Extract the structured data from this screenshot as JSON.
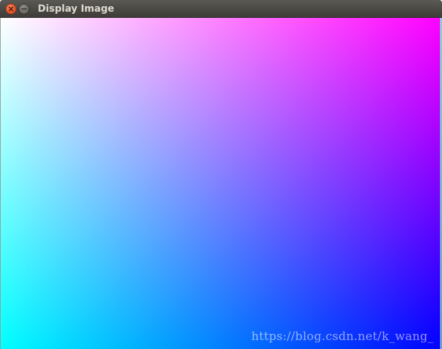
{
  "window": {
    "title": "Display Image",
    "controls": {
      "close_icon": "close-icon",
      "minimize_icon": "minimize-icon"
    },
    "colors": {
      "titlebar": "#4a4944",
      "title_text": "#dfdbd2",
      "close_button": "#e9592e",
      "minimize_button": "#6d6b65"
    }
  },
  "image": {
    "description_colors": {
      "top_left": "#ffffff",
      "top_right": "#ff00ff",
      "bottom_left": "#00ffff",
      "bottom_right": "#4400ff"
    },
    "watermark": "https://blog.csdn.net/k_wang_"
  }
}
